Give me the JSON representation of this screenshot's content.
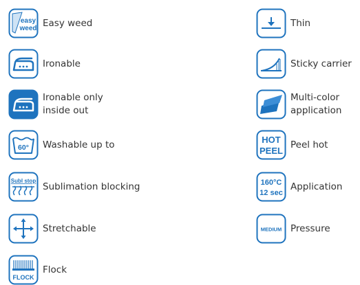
{
  "colors": {
    "brand_blue": "#1e73be",
    "text": "#333333"
  },
  "left_column": [
    {
      "icon": "easy-weed-icon",
      "label": "Easy weed",
      "icon_text": [
        "easy",
        "weed"
      ]
    },
    {
      "icon": "iron-icon",
      "label": "Ironable"
    },
    {
      "icon": "iron-inside-out-icon",
      "label_lines": [
        "Ironable only",
        "inside out"
      ]
    },
    {
      "icon": "wash-tub-icon",
      "label": "Washable up to",
      "icon_text": "60°"
    },
    {
      "icon": "sublimation-icon",
      "label": "Sublimation blocking",
      "icon_text": "Subl stop"
    },
    {
      "icon": "stretch-arrows-icon",
      "label": "Stretchable"
    },
    {
      "icon": "flock-icon",
      "label": "Flock",
      "icon_text": "FLOCK"
    }
  ],
  "right_column": [
    {
      "icon": "thin-icon",
      "label": "Thin"
    },
    {
      "icon": "sticky-carrier-icon",
      "label": "Sticky carrier"
    },
    {
      "icon": "multi-color-icon",
      "label_lines": [
        "Multi-color",
        "application"
      ]
    },
    {
      "icon": "peel-hot-icon",
      "label": "Peel hot",
      "icon_text": [
        "HOT",
        "PEEL"
      ]
    },
    {
      "icon": "application-icon",
      "label": "Application",
      "icon_text": [
        "160°C",
        "12 sec"
      ]
    },
    {
      "icon": "pressure-icon",
      "label": "Pressure",
      "icon_text": "MEDIUM"
    }
  ]
}
